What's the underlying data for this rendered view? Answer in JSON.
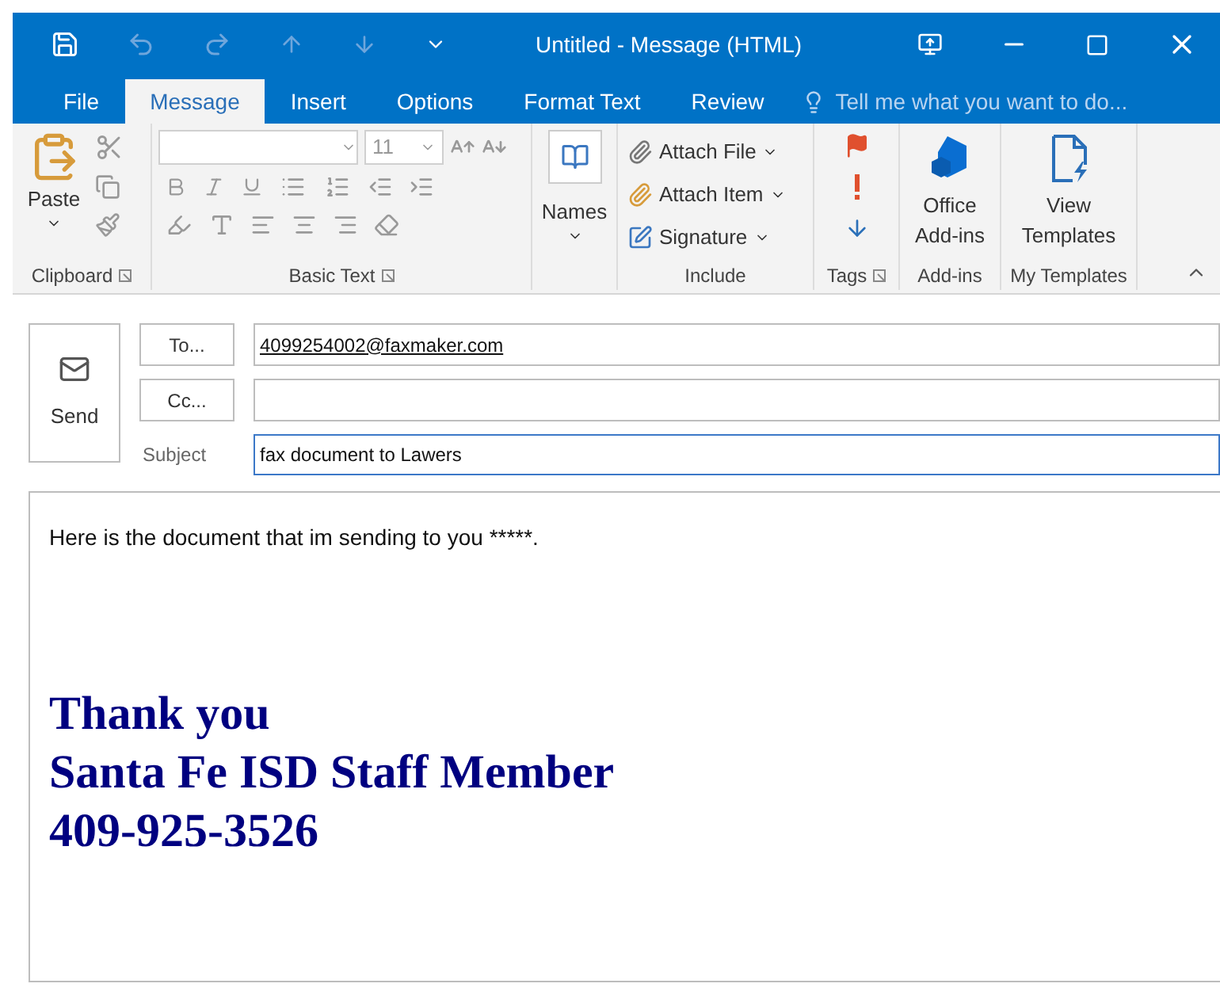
{
  "title_bar": {
    "title": "Untitled - Message (HTML)"
  },
  "tabs": [
    {
      "label": "File",
      "selected": false
    },
    {
      "label": "Message",
      "selected": true
    },
    {
      "label": "Insert",
      "selected": false
    },
    {
      "label": "Options",
      "selected": false
    },
    {
      "label": "Format Text",
      "selected": false
    },
    {
      "label": "Review",
      "selected": false
    }
  ],
  "tell_me": {
    "placeholder": "Tell me what you want to do..."
  },
  "ribbon": {
    "clipboard": {
      "label": "Clipboard",
      "paste": "Paste"
    },
    "basic_text": {
      "label": "Basic Text",
      "font_size": "11"
    },
    "names": {
      "label": "Names"
    },
    "include": {
      "label": "Include",
      "items": [
        "Attach File",
        "Attach Item",
        "Signature"
      ]
    },
    "tags": {
      "label": "Tags"
    },
    "add_ins": {
      "label": "Add-ins",
      "button": "Office Add-ins"
    },
    "my_templates": {
      "label": "My Templates",
      "button": "View Templates"
    }
  },
  "compose": {
    "send": "Send",
    "to_button": "To...",
    "to_value": "4099254002@faxmaker.com",
    "cc_button": "Cc...",
    "subject_label": "Subject",
    "subject_value": "fax document to Lawers"
  },
  "body": {
    "text": "Here is the document that im sending to you *****.",
    "signature": [
      "Thank you",
      "Santa Fe ISD Staff Member",
      "409-925-3526"
    ]
  }
}
